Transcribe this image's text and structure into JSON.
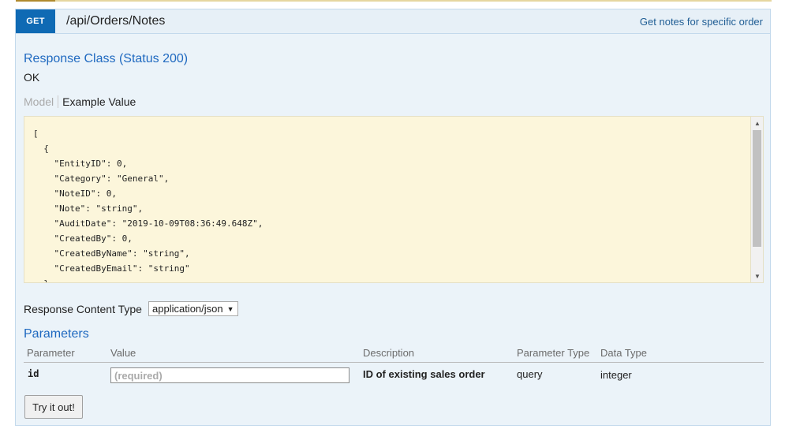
{
  "operation": {
    "method": "GET",
    "path": "/api/Orders/Notes",
    "summary": "Get notes for specific order"
  },
  "response": {
    "class_title": "Response Class (Status 200)",
    "status_text": "OK",
    "tabs": [
      {
        "label": "Model",
        "active": false
      },
      {
        "label": "Example Value",
        "active": true
      }
    ],
    "example_lines": [
      "[",
      "  {",
      "    \"EntityID\": 0,",
      "    \"Category\": \"General\",",
      "    \"NoteID\": 0,",
      "    \"Note\": \"string\",",
      "    \"AuditDate\": \"2019-10-09T08:36:49.648Z\",",
      "    \"CreatedBy\": 0,",
      "    \"CreatedByName\": \"string\",",
      "    \"CreatedByEmail\": \"string\"",
      "  }"
    ]
  },
  "content_type": {
    "label": "Response Content Type",
    "selected": "application/json"
  },
  "parameters": {
    "title": "Parameters",
    "headers": [
      "Parameter",
      "Value",
      "Description",
      "Parameter Type",
      "Data Type"
    ],
    "rows": [
      {
        "name": "id",
        "placeholder": "(required)",
        "description": "ID of existing sales order",
        "param_type": "query",
        "data_type": "integer"
      }
    ]
  },
  "actions": {
    "try_label": "Try it out!"
  },
  "colors": {
    "method_get": "#0f6ab4",
    "section_bg": "#ebf3f9",
    "heading_blue": "#1f69c0",
    "code_bg": "#fcf6db"
  }
}
